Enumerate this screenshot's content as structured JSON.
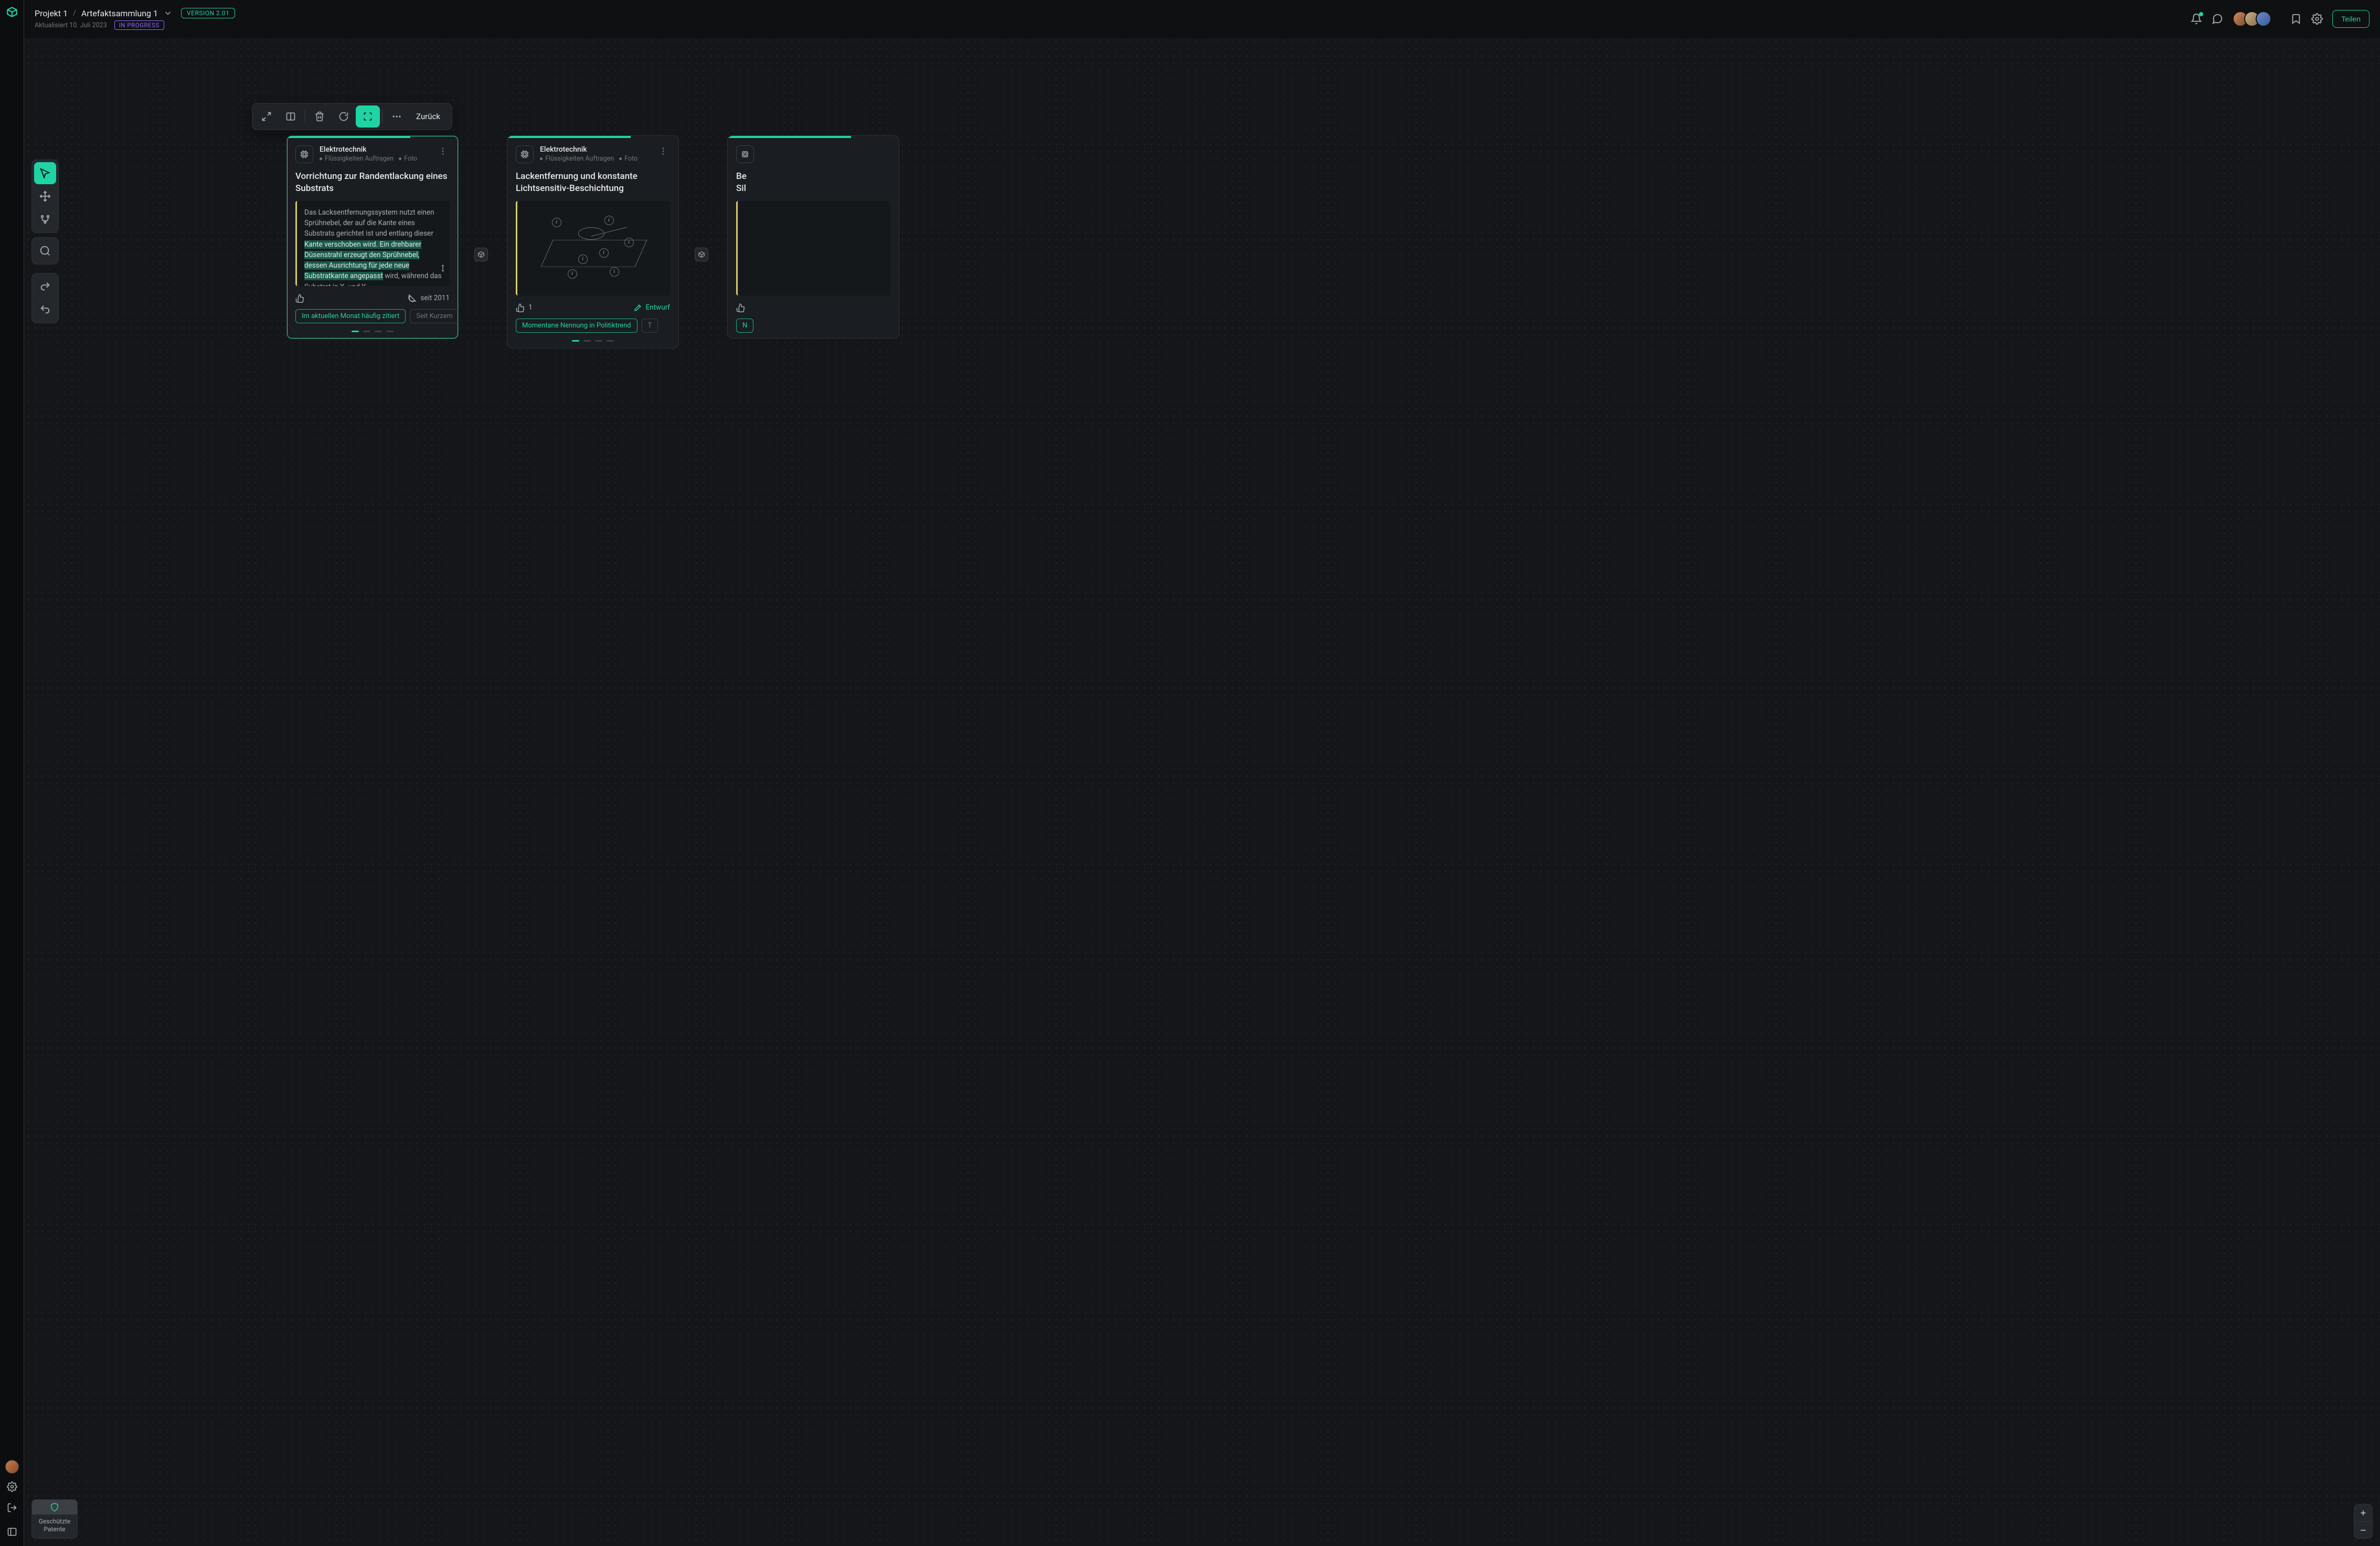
{
  "breadcrumb": {
    "project": "Projekt 1",
    "collection": "Artefaktsammlung 1"
  },
  "version_label": "VERSION 2.01",
  "updated_label": "Aktualisiert 10. Juli 2023",
  "status_label": "IN PROGRESS",
  "share_label": "Teilen",
  "floating_bar": {
    "back_label": "Zurück"
  },
  "bottom_badge": {
    "line1": "Geschützte",
    "line2": "Patente"
  },
  "cards": [
    {
      "category": "Elektrotechnik",
      "tags": [
        "Flüssigkeiten Auftragen",
        "Foto"
      ],
      "title": "Vorrichtung zur Randentlackung eines Substrats",
      "body_pre": "Das Lacksentfernungssystem nutzt einen Sprühnebel, der auf die Kante eines Substrats gerichtet ist und entlang dieser ",
      "body_hl": "Kante verschoben wird. Ein drehbarer Düsenstrahl erzeugt den Sprühnebel, dessen Ausrichtung für jede neue Substratkante angepasst",
      "body_post": " wird, während das Substrat in X- und Y-",
      "like_count": "",
      "meta_label": "seit 2011",
      "chips": [
        "Im aktuellen Monat häufig zitiert",
        "Seit Kurzem"
      ]
    },
    {
      "category": "Elektrotechnik",
      "tags": [
        "Flüssigkeiten Auftragen",
        "Foto"
      ],
      "title": "Lackentfernung und konstante Lichtsensitiv-Beschichtung",
      "like_count": "1",
      "meta_label": "Entwurf",
      "chips": [
        "Momentane Nennung in Politiktrend",
        "T"
      ]
    },
    {
      "category": "",
      "title_line1": "Be",
      "title_line2": "Sil",
      "chip": "N"
    }
  ]
}
